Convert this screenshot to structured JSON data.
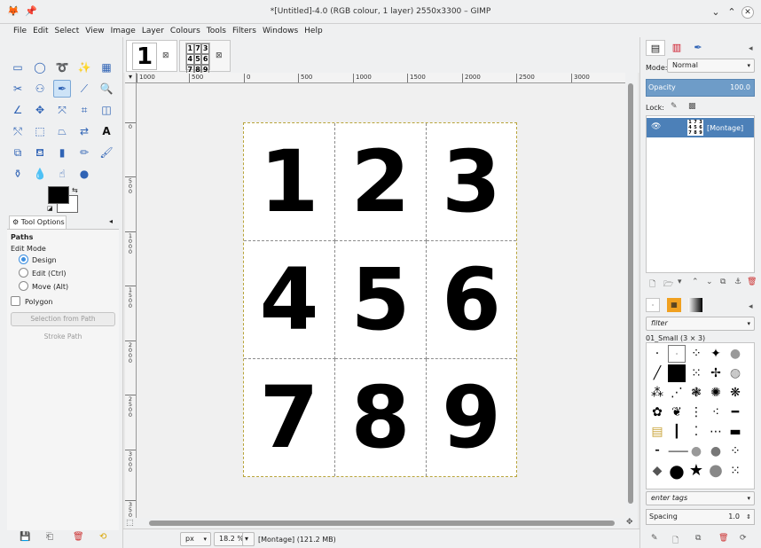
{
  "window": {
    "title": "*[Untitled]-4.0 (RGB colour, 1 layer) 2550x3300 – GIMP",
    "controls": {
      "minimize": "⌄",
      "maximize": "⌃",
      "close": "✕"
    }
  },
  "menu": [
    "File",
    "Edit",
    "Select",
    "View",
    "Image",
    "Layer",
    "Colours",
    "Tools",
    "Filters",
    "Windows",
    "Help"
  ],
  "image_tabs": [
    {
      "thumb": "1"
    },
    {
      "thumb": [
        "1",
        "7",
        "3",
        "4",
        "5",
        "6",
        "7",
        "8",
        "9"
      ]
    }
  ],
  "rulers": {
    "h": [
      "1000",
      "500",
      "0",
      "500",
      "1000",
      "1500",
      "2000",
      "2500",
      "3000"
    ],
    "v": [
      "0",
      "5\n0\n0",
      "1\n0\n0\n0",
      "1\n5\n0\n0",
      "2\n0\n0\n0",
      "2\n5\n0\n0",
      "3\n0\n0\n0",
      "3\n5\n0\n0"
    ],
    "corner": "▾"
  },
  "montage": {
    "digits": [
      "1",
      "2",
      "3",
      "4",
      "5",
      "6",
      "7",
      "8",
      "9"
    ]
  },
  "tool_options": {
    "tab_label": "Tool Options",
    "section": "Paths",
    "edit_mode_label": "Edit Mode",
    "modes": [
      "Design",
      "Edit (Ctrl)",
      "Move (Alt)"
    ],
    "selected_mode": "Design",
    "polygon_label": "Polygon",
    "selection_from_path": "Selection from Path",
    "stroke_path": "Stroke Path"
  },
  "status": {
    "unit": "px",
    "zoom": "18.2 %",
    "message": "[Montage] (121.2 MB)"
  },
  "layers": {
    "mode_label": "Mode:",
    "mode_value": "Normal",
    "opacity_label": "Opacity",
    "opacity_value": "100.0",
    "lock_label": "Lock:",
    "layer_name": "[Montage]",
    "thumb": [
      "1",
      "7",
      "3",
      "4",
      "5",
      "6",
      "7",
      "8",
      "9"
    ]
  },
  "brushes": {
    "filter_placeholder": "filter",
    "current_brush": "01_Small (3 × 3)",
    "tags_placeholder": "enter tags",
    "spacing_label": "Spacing",
    "spacing_value": "1.0"
  },
  "colors": {
    "accent": "#4c80b8",
    "opacity_bar": "#6e9cc8",
    "foreground": "#000000",
    "background": "#ffffff"
  }
}
